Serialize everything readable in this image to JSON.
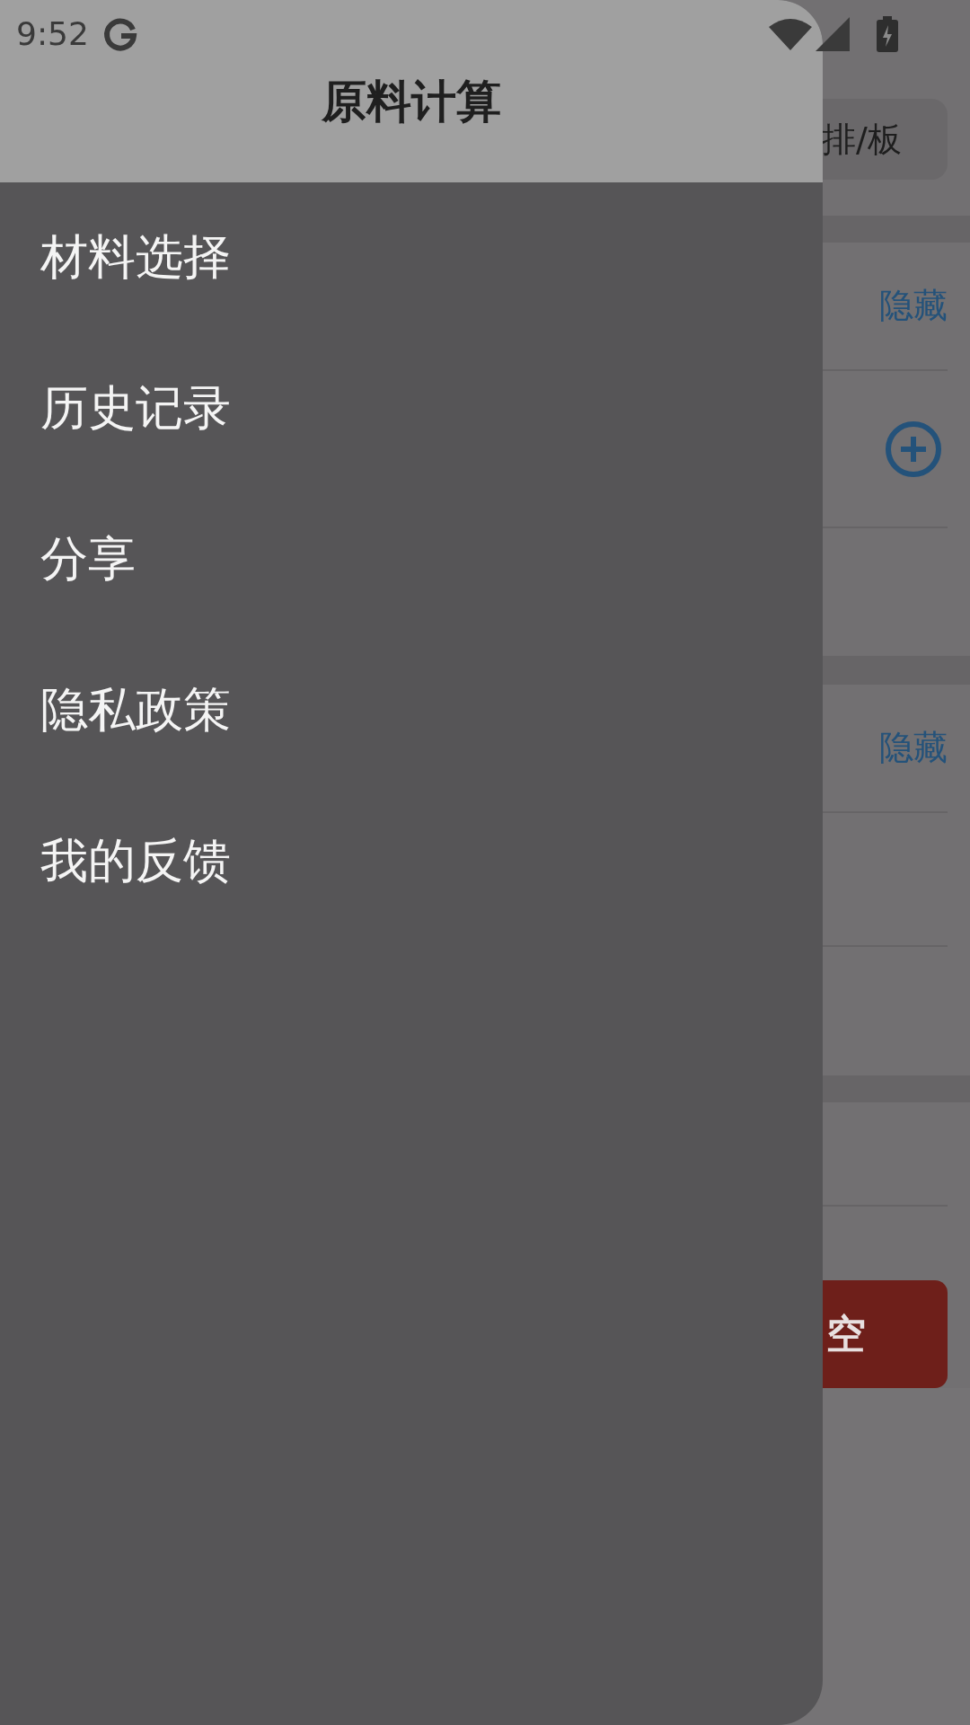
{
  "status_bar": {
    "time": "9:52"
  },
  "drawer": {
    "title": "原料计算",
    "items": [
      {
        "label": "材料选择"
      },
      {
        "label": "历史记录"
      },
      {
        "label": "分享"
      },
      {
        "label": "隐私政策"
      },
      {
        "label": "我的反馈"
      }
    ]
  },
  "background": {
    "top_button": "排/板",
    "section_1": {
      "toggle": "隐藏"
    },
    "section_2": {
      "toggle": "隐藏"
    },
    "clear_button": "空"
  }
}
